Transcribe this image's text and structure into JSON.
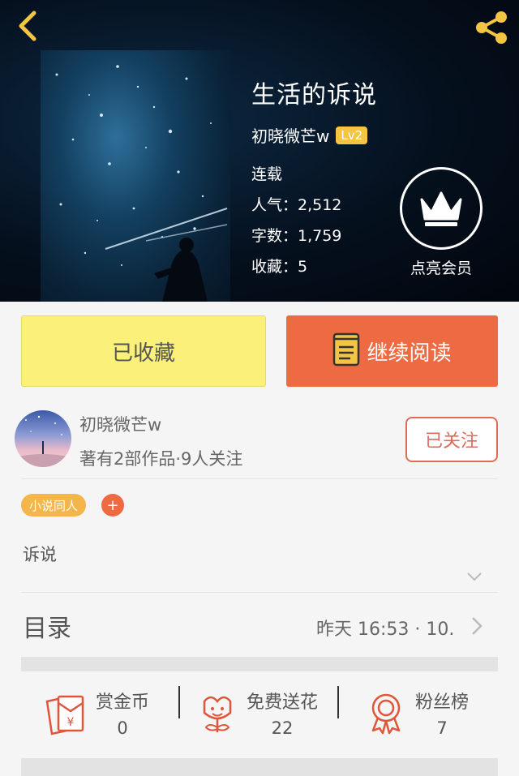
{
  "header": {
    "title": "生活的诉说",
    "author": "初晓微芒w",
    "level_badge": "Lv2",
    "status": "连载",
    "popularity": "人气：2,512",
    "word_count": "字数：1,759",
    "favorites": "收藏：5",
    "vip_label": "点亮会员"
  },
  "actions": {
    "collected_label": "已收藏",
    "read_label": "继续阅读"
  },
  "author_card": {
    "name": "初晓微芒w",
    "meta": "著有2部作品·9人关注",
    "follow_label": "已关注"
  },
  "tags": {
    "items": [
      "小说同人"
    ],
    "add_label": "+"
  },
  "summary": "诉说",
  "toc": {
    "label": "目录",
    "latest": "昨天 16:53 · 10."
  },
  "stats": {
    "reward": {
      "title": "赏金币",
      "value": "0"
    },
    "flowers": {
      "title": "免费送花",
      "value": "22"
    },
    "fans": {
      "title": "粉丝榜",
      "value": "7"
    }
  },
  "colors": {
    "accent": "#ee6a42",
    "collected_bg": "#fbf07a",
    "badge": "#f4c542",
    "back_arrow": "#f4c542"
  },
  "icons": [
    "back-arrow-icon",
    "share-icon",
    "crown-icon",
    "book-icon",
    "red-envelope-icon",
    "flower-icon",
    "medal-icon",
    "chevron-down-icon",
    "chevron-right-icon"
  ]
}
